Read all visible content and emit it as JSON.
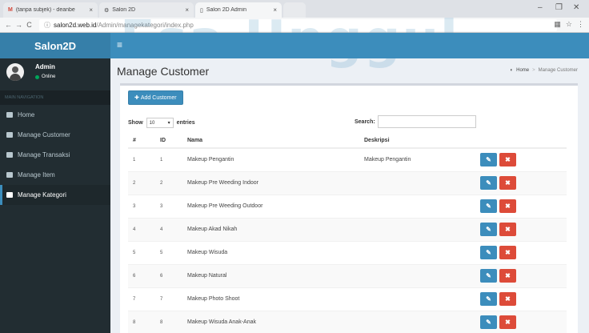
{
  "browser": {
    "tabs": [
      {
        "label": "(tanpa subjek) - deanbe",
        "icon": "gmail-icon"
      },
      {
        "label": "Salon 2D",
        "icon": "gear-icon"
      },
      {
        "label": "Salon 2D Admin",
        "icon": "page-icon"
      }
    ],
    "url_host": "salon2d.web.id",
    "url_path": "/Admin/managekategori/index.php"
  },
  "app": {
    "logo": "Salon2D",
    "watermark": "Esa Unggul"
  },
  "user": {
    "name": "Admin",
    "status": "Online"
  },
  "sidebar": {
    "header": "MAIN NAVIGATION",
    "items": [
      {
        "label": "Home"
      },
      {
        "label": "Manage Customer"
      },
      {
        "label": "Manage Transaksi"
      },
      {
        "label": "Manage Item"
      },
      {
        "label": "Manage Kategori"
      }
    ]
  },
  "page": {
    "title": "Manage Customer",
    "breadcrumb_home": "Home",
    "breadcrumb_current": "Manage Customer"
  },
  "toolbar": {
    "add_label": "Add Customer"
  },
  "table_controls": {
    "show": "Show",
    "entries_value": "10",
    "entries": "entries",
    "search": "Search:"
  },
  "table": {
    "headers": [
      "#",
      "ID",
      "Nama",
      "Deskripsi"
    ],
    "rows": [
      {
        "no": "1",
        "id": "1",
        "nama": "Makeup Pengantin",
        "deskripsi": "Makeup Pengantin"
      },
      {
        "no": "2",
        "id": "2",
        "nama": "Makeup Pre Weeding Indoor",
        "deskripsi": ""
      },
      {
        "no": "3",
        "id": "3",
        "nama": "Makeup Pre Weeding Outdoor",
        "deskripsi": ""
      },
      {
        "no": "4",
        "id": "4",
        "nama": "Makeup Akad Nikah",
        "deskripsi": ""
      },
      {
        "no": "5",
        "id": "5",
        "nama": "Makeup Wisuda",
        "deskripsi": ""
      },
      {
        "no": "6",
        "id": "6",
        "nama": "Makeup Natural",
        "deskripsi": ""
      },
      {
        "no": "7",
        "id": "7",
        "nama": "Makeup Photo Shoot",
        "deskripsi": ""
      },
      {
        "no": "8",
        "id": "8",
        "nama": "Makeup Wisuda Anak-Anak",
        "deskripsi": ""
      }
    ]
  }
}
